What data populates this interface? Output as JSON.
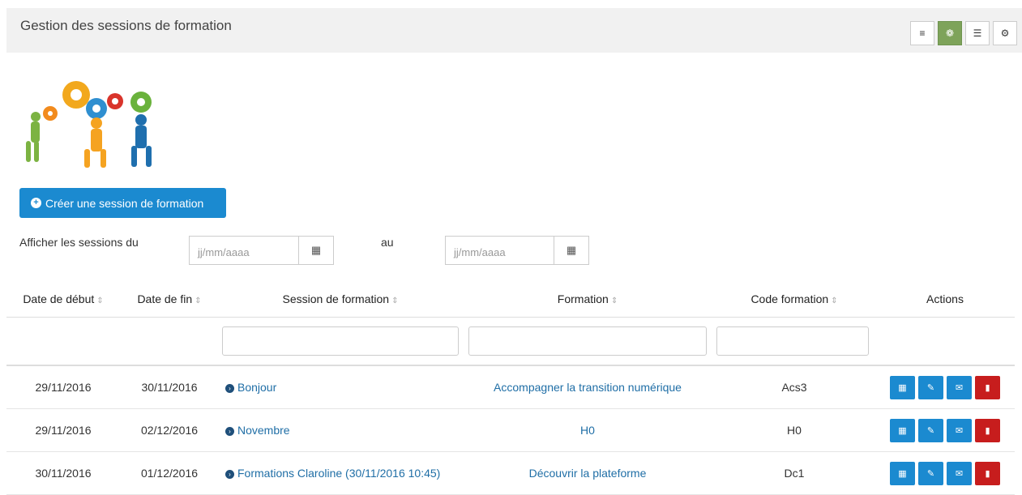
{
  "header": {
    "title": "Gestion des sessions de formation"
  },
  "view_buttons": [
    {
      "icon": "list-icon",
      "symbol": "≡",
      "active": false
    },
    {
      "icon": "calendar-gears-icon",
      "symbol": "❁",
      "active": true
    },
    {
      "icon": "database-icon",
      "symbol": "☰",
      "active": false
    },
    {
      "icon": "settings-icon",
      "symbol": "⚙",
      "active": false
    }
  ],
  "create_button": {
    "icon": "plus-circle-icon",
    "label": "Créer une session de formation"
  },
  "filter": {
    "label_from": "Afficher les sessions du",
    "label_to": "au",
    "from_placeholder": "jj/mm/aaaa",
    "to_placeholder": "jj/mm/aaaa"
  },
  "table": {
    "columns": [
      "Date de début",
      "Date de fin",
      "Session de formation",
      "Formation",
      "Code formation",
      "Actions"
    ],
    "rows": [
      {
        "start": "29/11/2016",
        "end": "30/11/2016",
        "session": "Bonjour",
        "formation": "Accompagner la transition numérique",
        "code": "Acs3"
      },
      {
        "start": "29/11/2016",
        "end": "02/12/2016",
        "session": "Novembre",
        "formation": "H0",
        "code": "H0"
      },
      {
        "start": "30/11/2016",
        "end": "01/12/2016",
        "session": "Formations Claroline (30/11/2016 10:45)",
        "formation": "Découvrir la plateforme",
        "code": "Dc1"
      }
    ]
  },
  "colors": {
    "primary": "#1b8ad0",
    "danger": "#c71d1d",
    "active_view": "#7ea35a",
    "link": "#1f6ea6"
  }
}
